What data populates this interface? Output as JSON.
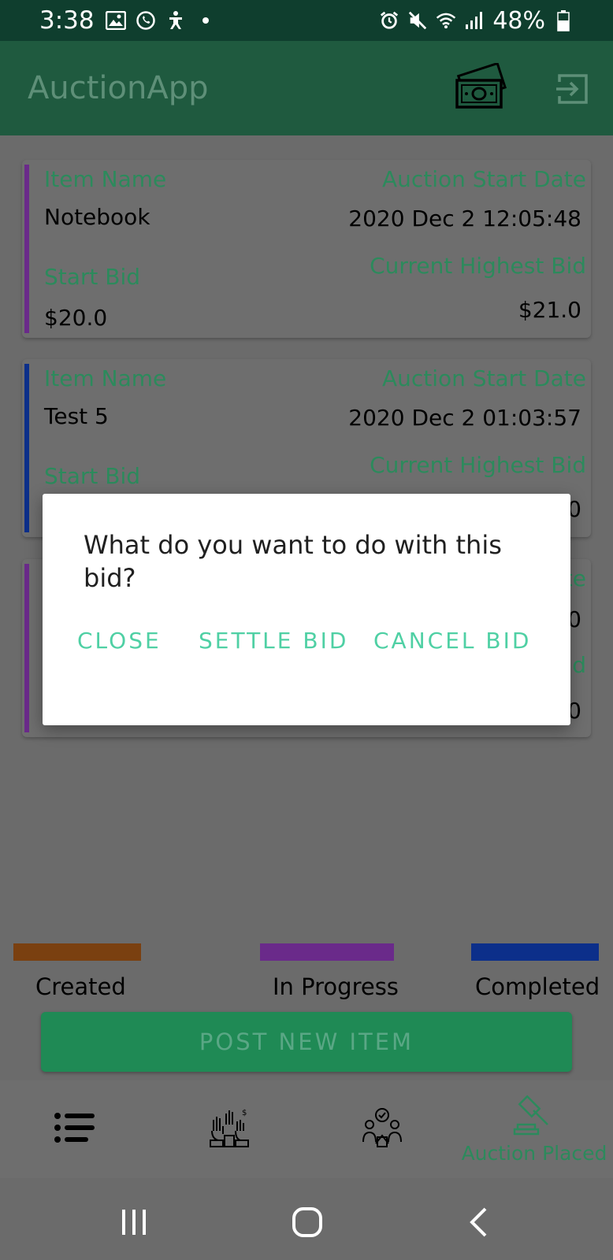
{
  "status_bar": {
    "time": "3:38",
    "battery": "48%"
  },
  "app_bar": {
    "title": "AuctionApp"
  },
  "cards": [
    {
      "stripe_color": "#6a2a8a",
      "item_name_label": "Item Name",
      "item_name": "Notebook",
      "start_date_label": "Auction Start Date",
      "start_date": "2020 Dec 2 12:05:48",
      "start_bid_label": "Start Bid",
      "start_bid": "$20.0",
      "highest_bid_label": "Current Highest Bid",
      "highest_bid": "$21.0"
    },
    {
      "stripe_color": "#0c2f8a",
      "item_name_label": "Item Name",
      "item_name": "Test 5",
      "start_date_label": "Auction Start Date",
      "start_date": "2020 Dec 2 01:03:57",
      "start_bid_label": "Start Bid",
      "highest_bid_label": "Current Highest Bid",
      "highest_bid_tail": "0"
    },
    {
      "stripe_color": "#6a2a8a",
      "date_label_tail": "te",
      "date_tail": "0",
      "highest_label_tail": "id",
      "highest_tail": "0"
    }
  ],
  "legend": [
    {
      "label": "Created",
      "color": "#7a4010"
    },
    {
      "label": "In Progress",
      "color": "#6a2a8a"
    },
    {
      "label": "Completed",
      "color": "#0c2f8a"
    }
  ],
  "post_button": "POST NEW ITEM",
  "bottom_nav": {
    "items": [
      {
        "icon": "list-icon"
      },
      {
        "icon": "bidding-hands-icon"
      },
      {
        "icon": "approval-people-icon"
      },
      {
        "icon": "gavel-icon",
        "label": "Auction Placed"
      }
    ]
  },
  "dialog": {
    "message": "What do you want to do with this bid?",
    "close": "CLOSE",
    "settle": "SETTLE BID",
    "cancel": "CANCEL BID"
  },
  "colors": {
    "accent": "#2c8a5c",
    "dialog_button": "#4fd0a4",
    "app_bar": "#1f5a3f",
    "status_bar": "#0f3e2e"
  }
}
